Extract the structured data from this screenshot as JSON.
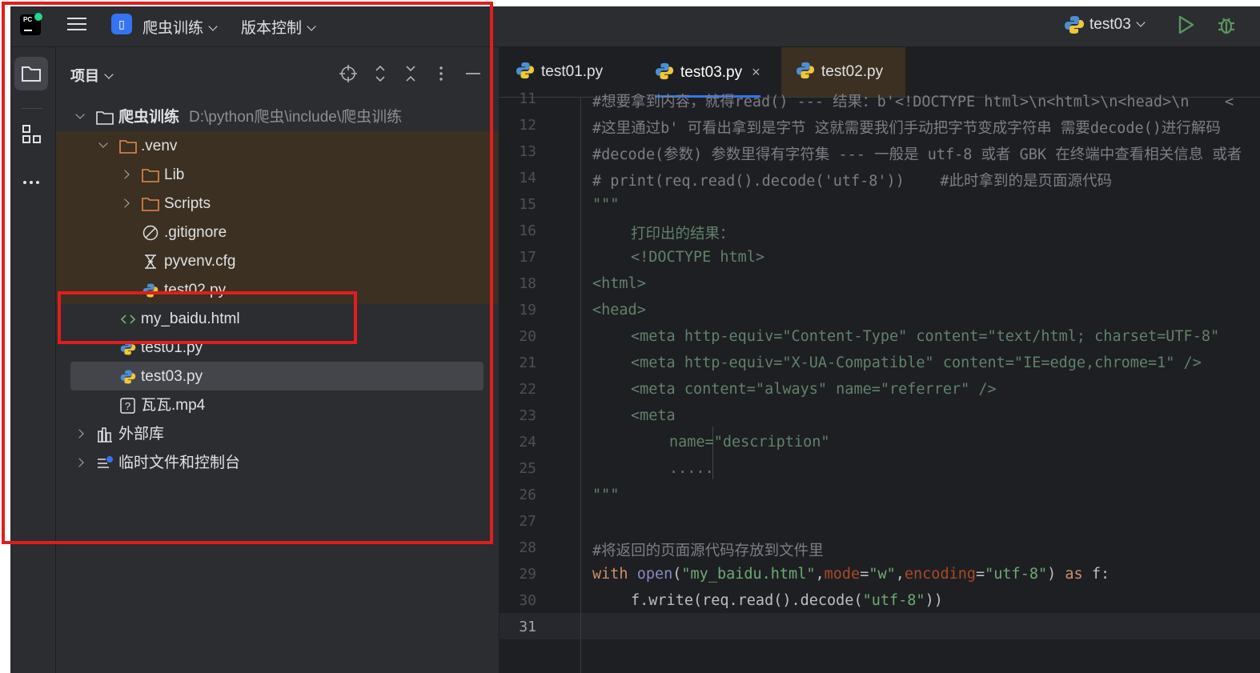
{
  "titlebar": {
    "project_name": "爬虫训练",
    "vcs_label": "版本控制",
    "run_config": "test03"
  },
  "panel": {
    "title": "项目",
    "tree": [
      {
        "label": "爬虫训练",
        "path": "D:\\python爬虫\\include\\爬虫训练"
      },
      {
        "label": ".venv"
      },
      {
        "label": "Lib"
      },
      {
        "label": "Scripts"
      },
      {
        "label": ".gitignore"
      },
      {
        "label": "pyvenv.cfg"
      },
      {
        "label": "test02.py"
      },
      {
        "label": "my_baidu.html"
      },
      {
        "label": "test01.py"
      },
      {
        "label": "test03.py"
      },
      {
        "label": "瓦瓦.mp4"
      },
      {
        "label": "外部库"
      },
      {
        "label": "临时文件和控制台"
      }
    ]
  },
  "tabs": [
    {
      "label": "test01.py"
    },
    {
      "label": "test03.py",
      "close": "×"
    },
    {
      "label": "test02.py"
    }
  ],
  "line_numbers": [
    "11",
    "12",
    "13",
    "14",
    "15",
    "16",
    "17",
    "18",
    "19",
    "20",
    "21",
    "22",
    "23",
    "24",
    "25",
    "26",
    "27",
    "28",
    "29",
    "30",
    "31"
  ],
  "code": {
    "l11": "#想要拿到内容，就得read() --- 结果：b'<!DOCTYPE html>\\n<html>\\n<head>\\n    <",
    "l12": "#这里通过b' 可看出拿到是字节 这就需要我们手动把字节变成字符串 需要decode()进行解码",
    "l13": "#decode(参数) 参数里得有字符集 --- 一般是 utf-8 或者 GBK 在终端中查看相关信息 或者",
    "l14a": "# print(req.read().decode('utf-8'))",
    "l14b": "#此时拿到的是页面源代码",
    "l15": "\"\"\"",
    "l16": "打印出的结果：",
    "l17": "<!DOCTYPE html>",
    "l18": "<html>",
    "l19": "<head>",
    "l20": "<meta http-equiv=\"Content-Type\" content=\"text/html; charset=UTF-8\"",
    "l21": "<meta http-equiv=\"X-UA-Compatible\" content=\"IE=edge,chrome=1\" />",
    "l22": "<meta content=\"always\" name=\"referrer\" />",
    "l23": "<meta",
    "l24": "name=\"description\"",
    "l25": ".....",
    "l26": "\"\"\"",
    "l28": "#将返回的页面源代码存放到文件里",
    "l29_with": "with",
    "l29_open": "open",
    "l29_p1": "(",
    "l29_s1": "\"my_baidu.html\"",
    "l29_c1": ",",
    "l29_mode": "mode",
    "l29_eq1": "=",
    "l29_s2": "\"w\"",
    "l29_c2": ",",
    "l29_enc": "encoding",
    "l29_eq2": "=",
    "l29_s3": "\"utf-8\"",
    "l29_p2": ")",
    "l29_as": "as",
    "l29_f": "f:",
    "l30a": "f.write(req.read().decode(",
    "l30s": "\"utf-8\"",
    "l30b": "))"
  },
  "colors": {
    "accent": "#3574f0",
    "annotation_red": "#e11d1d",
    "editor_bg": "#1e1f22",
    "panel_bg": "#2b2d30",
    "venv_highlight": "#3b3021"
  },
  "icons": [
    "pycharm-logo-icon",
    "hamburger-menu-icon",
    "run-icon",
    "debug-icon",
    "python-icon",
    "folder-icon",
    "structure-icon",
    "more-icon",
    "locate-icon",
    "expand-all-icon",
    "collapse-all-icon",
    "options-icon",
    "hide-icon",
    "ignore-file-icon",
    "config-file-icon",
    "html-file-icon",
    "unknown-file-icon",
    "library-icon",
    "scratches-icon"
  ]
}
